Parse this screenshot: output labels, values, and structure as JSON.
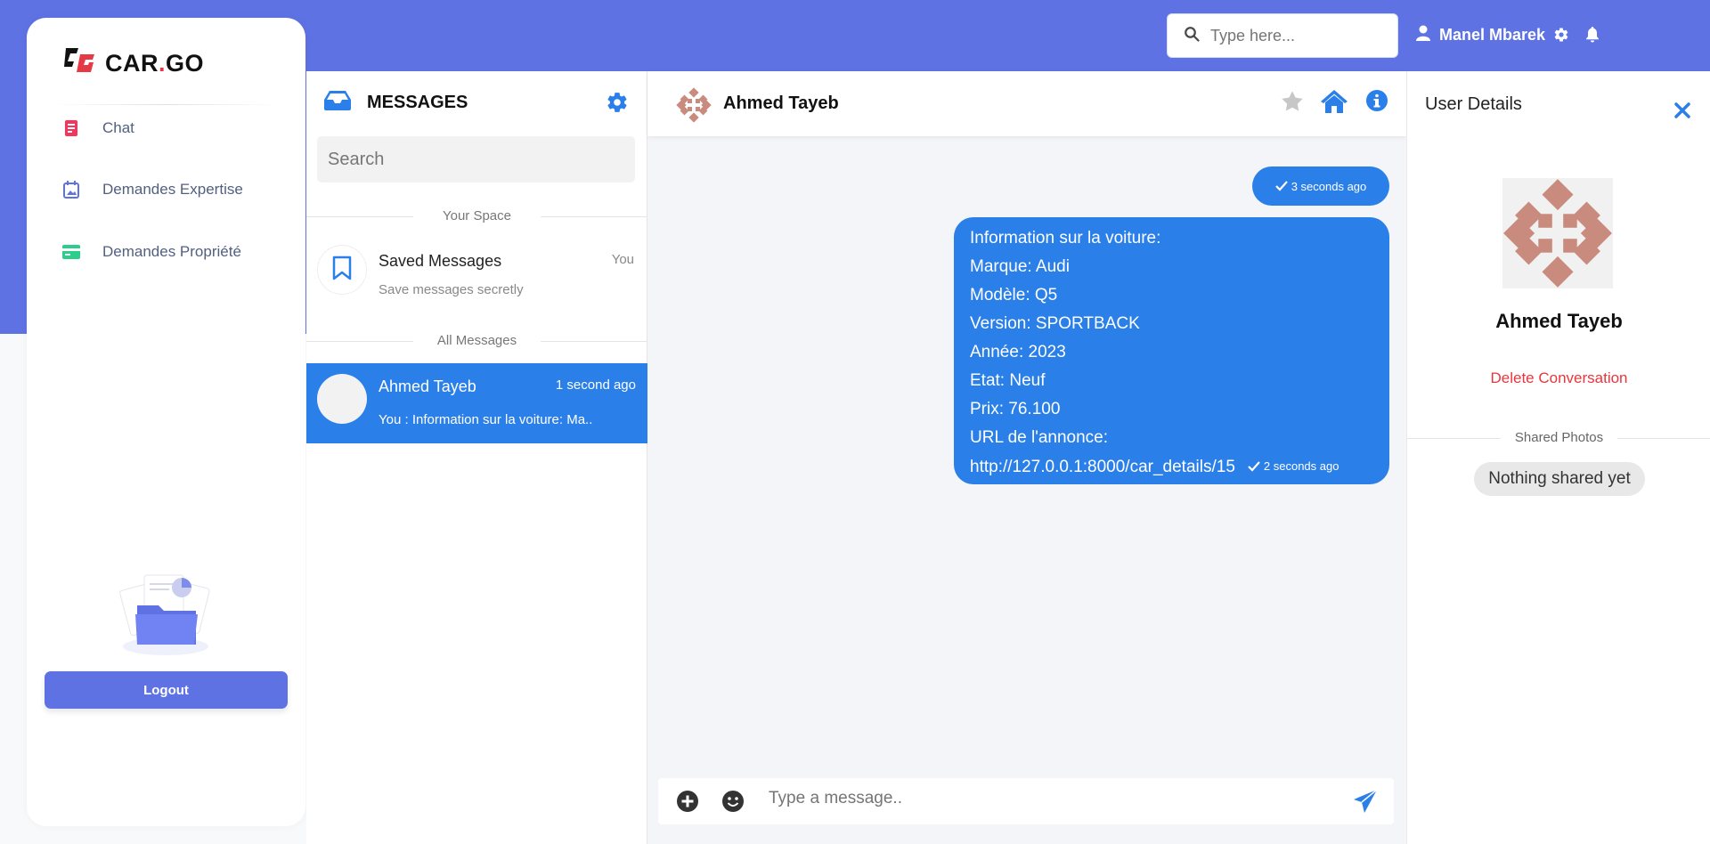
{
  "topbar": {
    "search_placeholder": "Type here...",
    "user_name": "Manel Mbarek"
  },
  "brand": {
    "name_part1": "CAR",
    "name_dot": ".",
    "name_part2": "GO"
  },
  "sidebar": {
    "items": [
      {
        "label": "Chat",
        "icon": "document-icon",
        "color": "#f5365c"
      },
      {
        "label": "Demandes Expertise",
        "icon": "calendar-image-icon",
        "color": "#5e72e4"
      },
      {
        "label": "Demandes Propriété",
        "icon": "credit-card-icon",
        "color": "#2dce89"
      }
    ],
    "logout_label": "Logout"
  },
  "messages": {
    "title": "MESSAGES",
    "search_placeholder": "Search",
    "your_space_label": "Your Space",
    "saved": {
      "name": "Saved Messages",
      "you_label": "You",
      "subtitle": "Save messages secretly"
    },
    "all_messages_label": "All Messages",
    "conversations": [
      {
        "name": "Ahmed Tayeb",
        "time": "1 second ago",
        "preview": "You : Information sur la voiture: Ma.."
      }
    ]
  },
  "chat": {
    "contact_name": "Ahmed Tayeb",
    "messages": [
      {
        "time": "3 seconds ago"
      },
      {
        "lines": [
          "Information sur la voiture:",
          "Marque: Audi",
          "Modèle: Q5",
          "Version: SPORTBACK",
          "Année: 2023",
          "Etat: Neuf",
          "Prix: 76.100",
          "URL de l'annonce:",
          "http://127.0.0.1:8000/car_details/15"
        ],
        "time": "2 seconds ago"
      }
    ],
    "input_placeholder": "Type a message.."
  },
  "details": {
    "title": "User Details",
    "name": "Ahmed Tayeb",
    "delete_label": "Delete Conversation",
    "shared_label": "Shared Photos",
    "empty_label": "Nothing shared yet"
  },
  "colors": {
    "primary": "#5e72e4",
    "chat_blue": "#2a7fe9",
    "danger": "#e9353b",
    "avatar_pattern": "#c98b7d"
  }
}
